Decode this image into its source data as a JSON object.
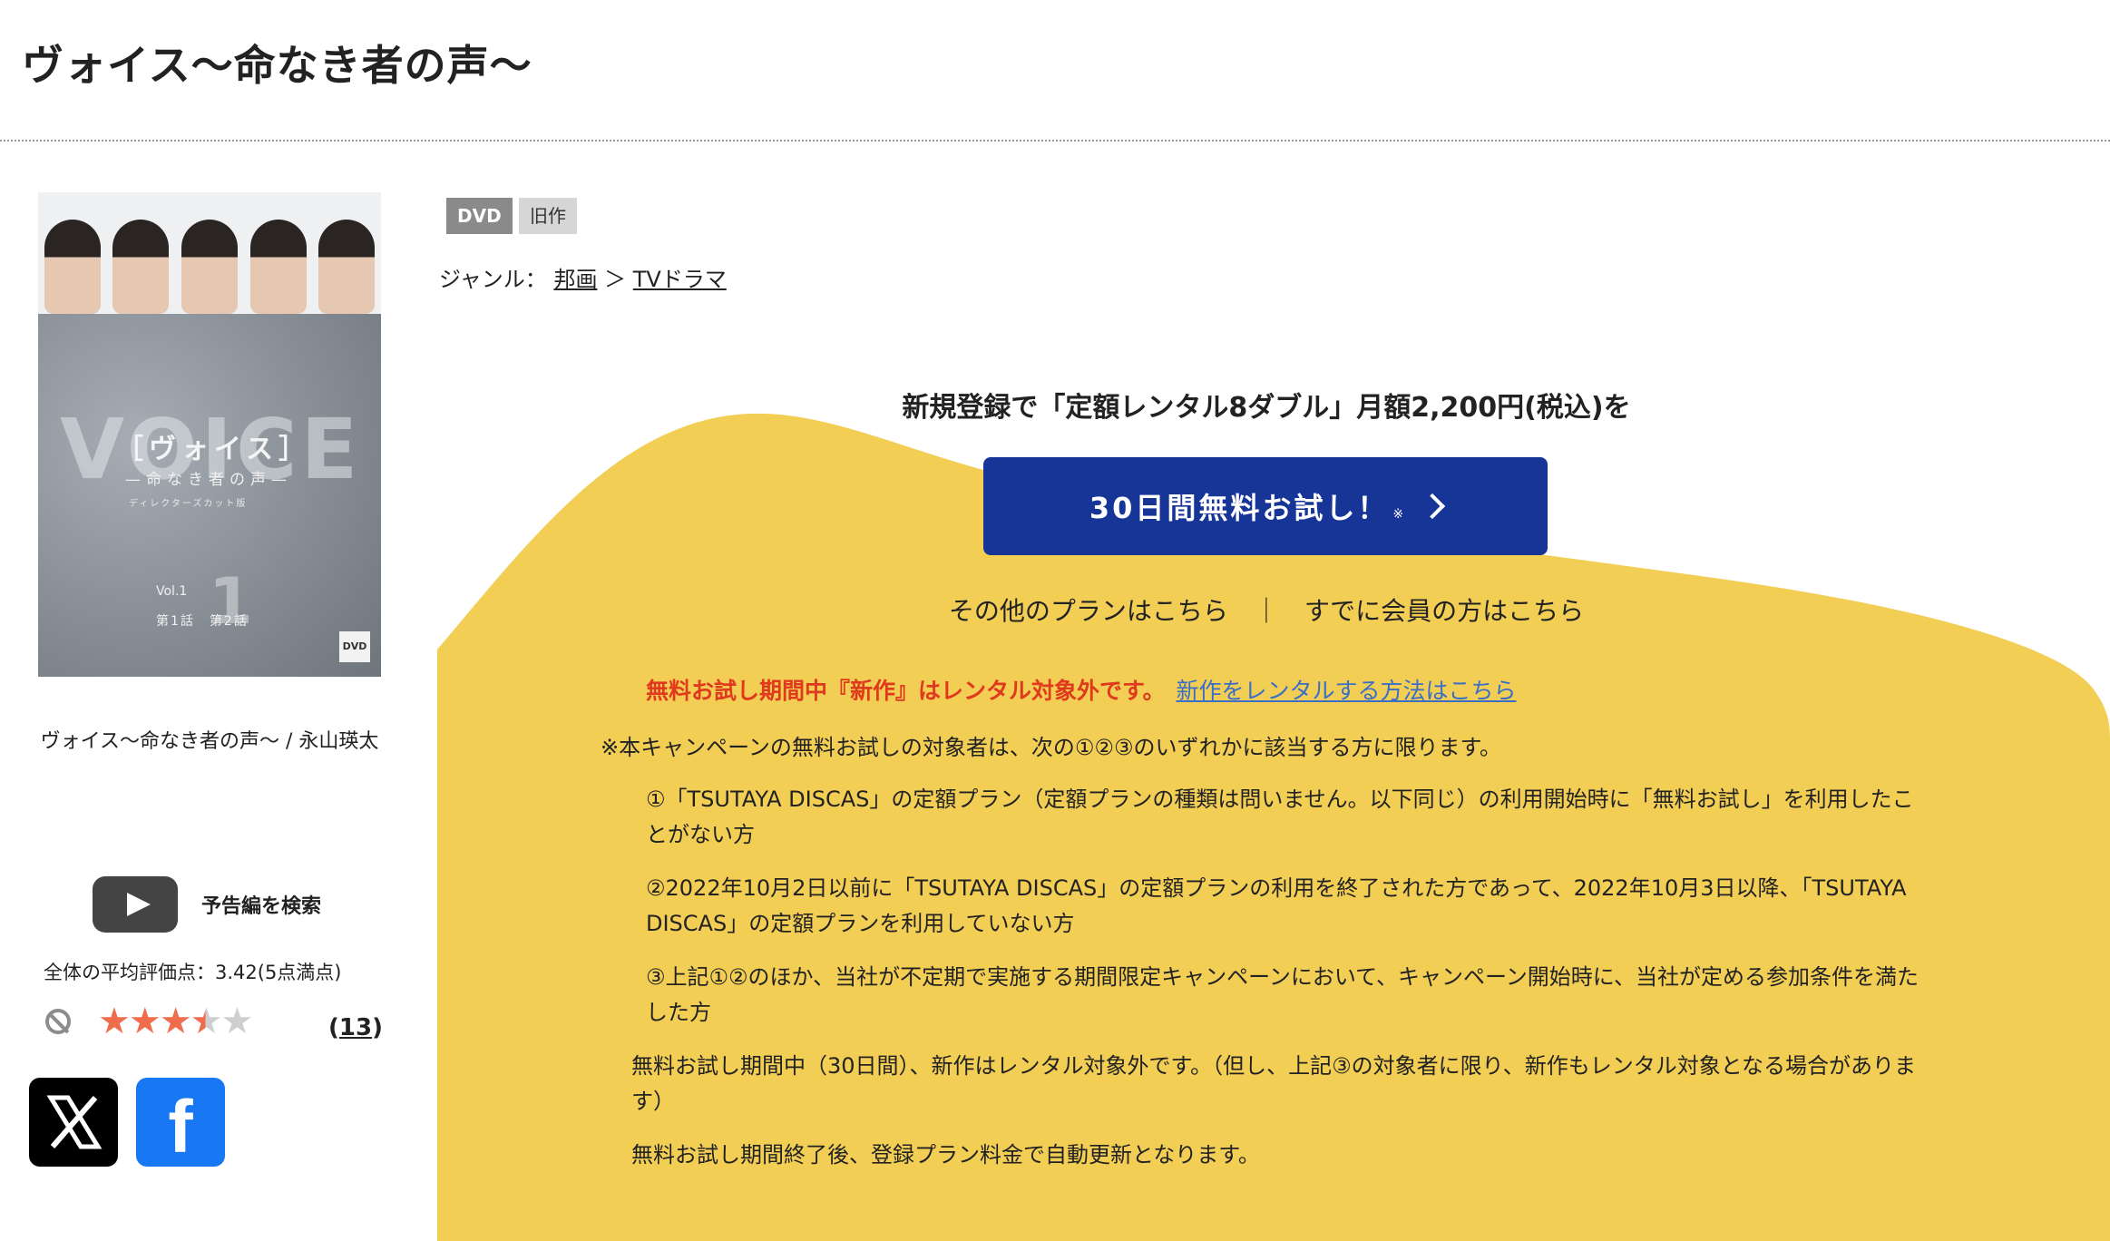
{
  "title": "ヴォイス〜命なき者の声〜",
  "cover": {
    "voice_text": "VOICE",
    "jp_title": "［ヴォイス］",
    "subtitle": "—命なき者の声—",
    "edition": "ディレクターズカット版",
    "volume": "Vol.1",
    "volume_number": "1",
    "episodes": "第1話　第2話",
    "dvd_mark": "DVD"
  },
  "cover_caption": "ヴォイス〜命なき者の声〜 / 永山瑛太",
  "trailer_label": "予告編を検索",
  "rating": {
    "label": "全体の平均評価点：",
    "value": "3.42(5点満点)",
    "stars_value": 3.42,
    "review_count_open": "(",
    "review_count": "13",
    "review_count_close": ")"
  },
  "tags": {
    "dvd": "DVD",
    "old": "旧作"
  },
  "genre": {
    "label": "ジャンル：",
    "link1": "邦画",
    "sep": "＞",
    "link2": "TVドラマ"
  },
  "campaign": {
    "headline": "新規登録で「定額レンタル8ダブル」月額2,200円(税込)を",
    "trial_button": "30日間無料お試し！",
    "trial_mark": "※",
    "other_plans": "その他のプランはこちら",
    "separator": "｜",
    "member_link": "すでに会員の方はこちら",
    "notice_red": "無料お試し期間中『新作』はレンタル対象外です。",
    "notice_link": "新作をレンタルする方法はこちら",
    "intro": "※本キャンペーンの無料お試しの対象者は、次の①②③のいずれかに該当する方に限ります。",
    "conditions": [
      "①「TSUTAYA DISCAS」の定額プラン（定額プランの種類は問いません。以下同じ）の利用開始時に「無料お試し」を利用したことがない方",
      "②2022年10月2日以前に「TSUTAYA DISCAS」の定額プランの利用を終了された方であって、2022年10月3日以降、「TSUTAYA DISCAS」の定額プランを利用していない方",
      "③上記①②のほか、当社が不定期で実施する期間限定キャンペーンにおいて、キャンペーン開始時に、当社が定める参加条件を満たした方"
    ],
    "notes": [
      "無料お試し期間中（30日間）、新作はレンタル対象外です。（但し、上記③の対象者に限り、新作もレンタル対象となる場合があります）",
      "無料お試し期間終了後、登録プラン料金で自動更新となります。"
    ]
  },
  "colors": {
    "campaign_yellow": "#f2ce55",
    "button_blue": "#173597",
    "notice_red": "#e03a1e",
    "link_blue": "#3a6ec7",
    "star_orange": "#ef6c4c"
  },
  "icons": [
    "play-icon",
    "no-sign-icon",
    "x-logo-icon",
    "facebook-icon",
    "chevron-right-icon"
  ]
}
